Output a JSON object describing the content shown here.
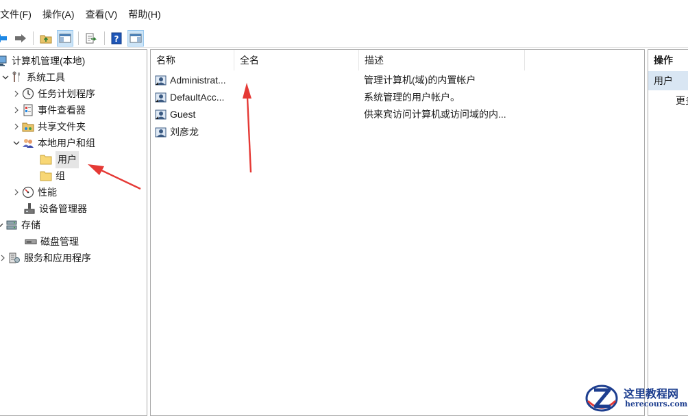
{
  "menu": {
    "file": "文件(F)",
    "action": "操作(A)",
    "view": "查看(V)",
    "help": "帮助(H)"
  },
  "toolbar": {
    "buttons": [
      "back-icon",
      "forward-icon",
      "up-folder-icon",
      "show-hide-tree-icon",
      "export-list-icon",
      "help-icon",
      "show-action-pane-icon"
    ]
  },
  "tree": {
    "root": "计算机管理(本地)",
    "system_tools": "系统工具",
    "task_scheduler": "任务计划程序",
    "event_viewer": "事件查看器",
    "shared_folders": "共享文件夹",
    "local_users_groups": "本地用户和组",
    "users": "用户",
    "groups": "组",
    "performance": "性能",
    "device_manager": "设备管理器",
    "storage": "存储",
    "disk_management": "磁盘管理",
    "services_apps": "服务和应用程序"
  },
  "list": {
    "columns": [
      "名称",
      "全名",
      "描述"
    ],
    "rows": [
      {
        "name": "Administrat...",
        "full_name": "",
        "description": "管理计算机(域)的内置帐户"
      },
      {
        "name": "DefaultAcc...",
        "full_name": "",
        "description": "系统管理的用户帐户。"
      },
      {
        "name": "Guest",
        "full_name": "",
        "description": "供来宾访问计算机或访问域的内..."
      },
      {
        "name": "刘彦龙",
        "full_name": "",
        "description": ""
      }
    ]
  },
  "actions": {
    "header": "操作",
    "selected": "用户",
    "more": "更多操作"
  },
  "watermark": {
    "title": "这里教程网",
    "url": "herecours.com"
  },
  "colors": {
    "selection_bg": "#e5e5e5",
    "action_selected_bg": "#d9e6f3",
    "annotation_arrow": "#e53935",
    "watermark_blue": "#1d3e8f"
  }
}
